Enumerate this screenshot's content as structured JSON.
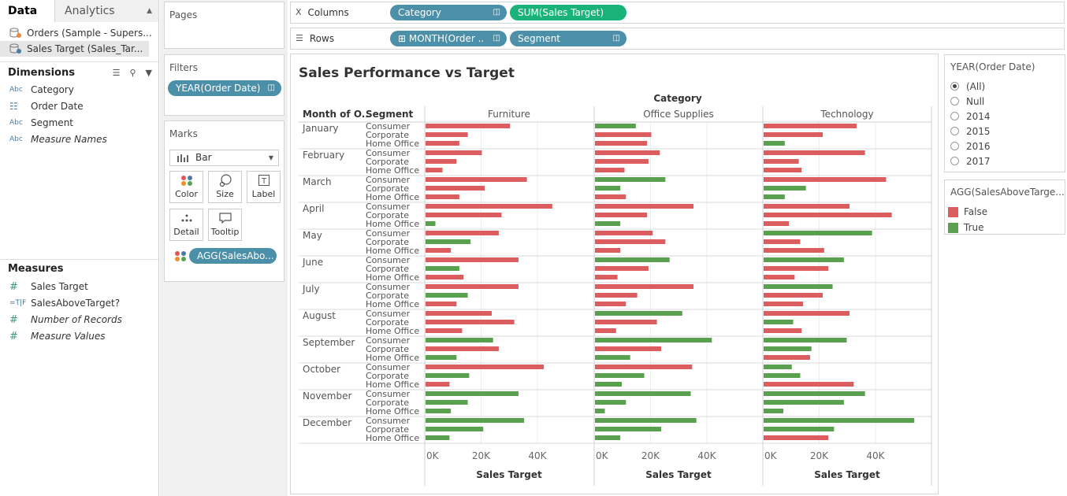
{
  "tabs": {
    "data": "Data",
    "analytics": "Analytics"
  },
  "datasources": [
    {
      "label": "Orders (Sample - Supers..."
    },
    {
      "label": "Sales Target (Sales_Tar..."
    }
  ],
  "dimensions": {
    "header": "Dimensions",
    "fields": [
      {
        "type": "Abc",
        "label": "Category",
        "italic": false
      },
      {
        "type": "date",
        "label": "Order Date",
        "italic": false
      },
      {
        "type": "Abc",
        "label": "Segment",
        "italic": false
      },
      {
        "type": "Abc",
        "label": "Measure Names",
        "italic": true
      }
    ]
  },
  "measures": {
    "header": "Measures",
    "fields": [
      {
        "type": "#",
        "label": "Sales Target",
        "italic": false
      },
      {
        "type": "=T|F",
        "label": "SalesAboveTarget?",
        "italic": false
      },
      {
        "type": "#",
        "label": "Number of Records",
        "italic": true
      },
      {
        "type": "#",
        "label": "Measure Values",
        "italic": true
      }
    ]
  },
  "cards": {
    "pages": "Pages",
    "filters": "Filters",
    "filter_pill": "YEAR(Order Date)",
    "marks": "Marks",
    "mark_type": "Bar",
    "mark_buttons": {
      "color": "Color",
      "size": "Size",
      "label": "Label",
      "detail": "Detail",
      "tooltip": "Tooltip"
    },
    "marks_pill": "AGG(SalesAbo..."
  },
  "shelves": {
    "columns_label": "Columns",
    "columns_pills": [
      "Category",
      "SUM(Sales Target)"
    ],
    "rows_label": "Rows",
    "rows_pills": [
      "MONTH(Order ..",
      "Segment"
    ]
  },
  "view": {
    "title": "Sales Performance vs Target"
  },
  "colors": {
    "false": "#dc5d5f",
    "true": "#59a14f",
    "pill_blue": "#4c8fa8",
    "pill_green": "#19b37a"
  },
  "year_filter": {
    "title": "YEAR(Order Date)",
    "options": [
      {
        "label": "(All)",
        "checked": true
      },
      {
        "label": "Null",
        "checked": false
      },
      {
        "label": "2014",
        "checked": false
      },
      {
        "label": "2015",
        "checked": false
      },
      {
        "label": "2016",
        "checked": false
      },
      {
        "label": "2017",
        "checked": false
      }
    ]
  },
  "color_legend": {
    "title": "AGG(SalesAboveTarge...",
    "items": [
      {
        "label": "False",
        "color": "#dc5d5f"
      },
      {
        "label": "True",
        "color": "#59a14f"
      }
    ]
  },
  "chart_data": {
    "type": "bar",
    "orientation": "horizontal",
    "column_header": "Category",
    "row_headers": [
      "Month of O..",
      "Segment"
    ],
    "panes": [
      "Furniture",
      "Office Supplies",
      "Technology"
    ],
    "months": [
      "January",
      "February",
      "March",
      "April",
      "May",
      "June",
      "July",
      "August",
      "September",
      "October",
      "November",
      "December"
    ],
    "segments": [
      "Consumer",
      "Corporate",
      "Home Office"
    ],
    "xlabel": "Sales Target",
    "xticks": [
      "0K",
      "20K",
      "40K"
    ],
    "xlim": [
      0,
      54000
    ],
    "color_legend": "SalesAboveTarget? (False = red, True = green)",
    "values": {
      "Furniture": [
        [
          30000,
          15000,
          12000
        ],
        [
          20000,
          11000,
          6000
        ],
        [
          36000,
          21000,
          12000
        ],
        [
          45000,
          27000,
          3500
        ],
        [
          26000,
          16000,
          9000
        ],
        [
          33000,
          12000,
          13500
        ],
        [
          33000,
          15000,
          11000
        ],
        [
          23500,
          31500,
          13000
        ],
        [
          24000,
          26000,
          11000
        ],
        [
          42000,
          15500,
          8500
        ],
        [
          33000,
          15000,
          9000
        ],
        [
          35000,
          20500,
          8500
        ]
      ],
      "Office Supplies": [
        [
          14500,
          20000,
          18500
        ],
        [
          23000,
          19000,
          10500
        ],
        [
          25000,
          9000,
          11000
        ],
        [
          35000,
          18500,
          9000
        ],
        [
          20500,
          25000,
          9000
        ],
        [
          26500,
          19000,
          8000
        ],
        [
          35000,
          15000,
          11000
        ],
        [
          31000,
          22000,
          7500
        ],
        [
          41500,
          23500,
          12500
        ],
        [
          34500,
          17500,
          9500
        ],
        [
          34000,
          11000,
          3500
        ],
        [
          36000,
          23500,
          9000
        ]
      ],
      "Technology": [
        [
          33000,
          21000,
          7500
        ],
        [
          36000,
          12500,
          13500
        ],
        [
          43500,
          15000,
          7500
        ],
        [
          30500,
          45500,
          9000
        ],
        [
          38500,
          13000,
          21500
        ],
        [
          28500,
          23000,
          11000
        ],
        [
          24500,
          21000,
          14000
        ],
        [
          30500,
          10500,
          13500
        ],
        [
          29500,
          17000,
          16500
        ],
        [
          10000,
          13000,
          32000
        ],
        [
          36000,
          28500,
          7000
        ],
        [
          53500,
          25000,
          23000
        ]
      ]
    },
    "above_target": {
      "Furniture": [
        [
          false,
          false,
          false
        ],
        [
          false,
          false,
          false
        ],
        [
          false,
          false,
          false
        ],
        [
          false,
          false,
          true
        ],
        [
          false,
          true,
          false
        ],
        [
          false,
          true,
          false
        ],
        [
          false,
          true,
          false
        ],
        [
          false,
          false,
          false
        ],
        [
          true,
          false,
          true
        ],
        [
          false,
          true,
          false
        ],
        [
          true,
          true,
          true
        ],
        [
          true,
          true,
          true
        ]
      ],
      "Office Supplies": [
        [
          true,
          false,
          false
        ],
        [
          false,
          false,
          false
        ],
        [
          true,
          true,
          false
        ],
        [
          false,
          false,
          true
        ],
        [
          false,
          false,
          false
        ],
        [
          true,
          false,
          false
        ],
        [
          false,
          false,
          false
        ],
        [
          true,
          false,
          false
        ],
        [
          true,
          false,
          true
        ],
        [
          false,
          true,
          true
        ],
        [
          true,
          true,
          true
        ],
        [
          true,
          true,
          true
        ]
      ],
      "Technology": [
        [
          false,
          false,
          true
        ],
        [
          false,
          false,
          false
        ],
        [
          false,
          true,
          true
        ],
        [
          false,
          false,
          false
        ],
        [
          true,
          false,
          false
        ],
        [
          true,
          false,
          false
        ],
        [
          true,
          false,
          false
        ],
        [
          false,
          true,
          false
        ],
        [
          true,
          true,
          false
        ],
        [
          true,
          true,
          false
        ],
        [
          true,
          true,
          true
        ],
        [
          true,
          true,
          false
        ]
      ]
    }
  }
}
